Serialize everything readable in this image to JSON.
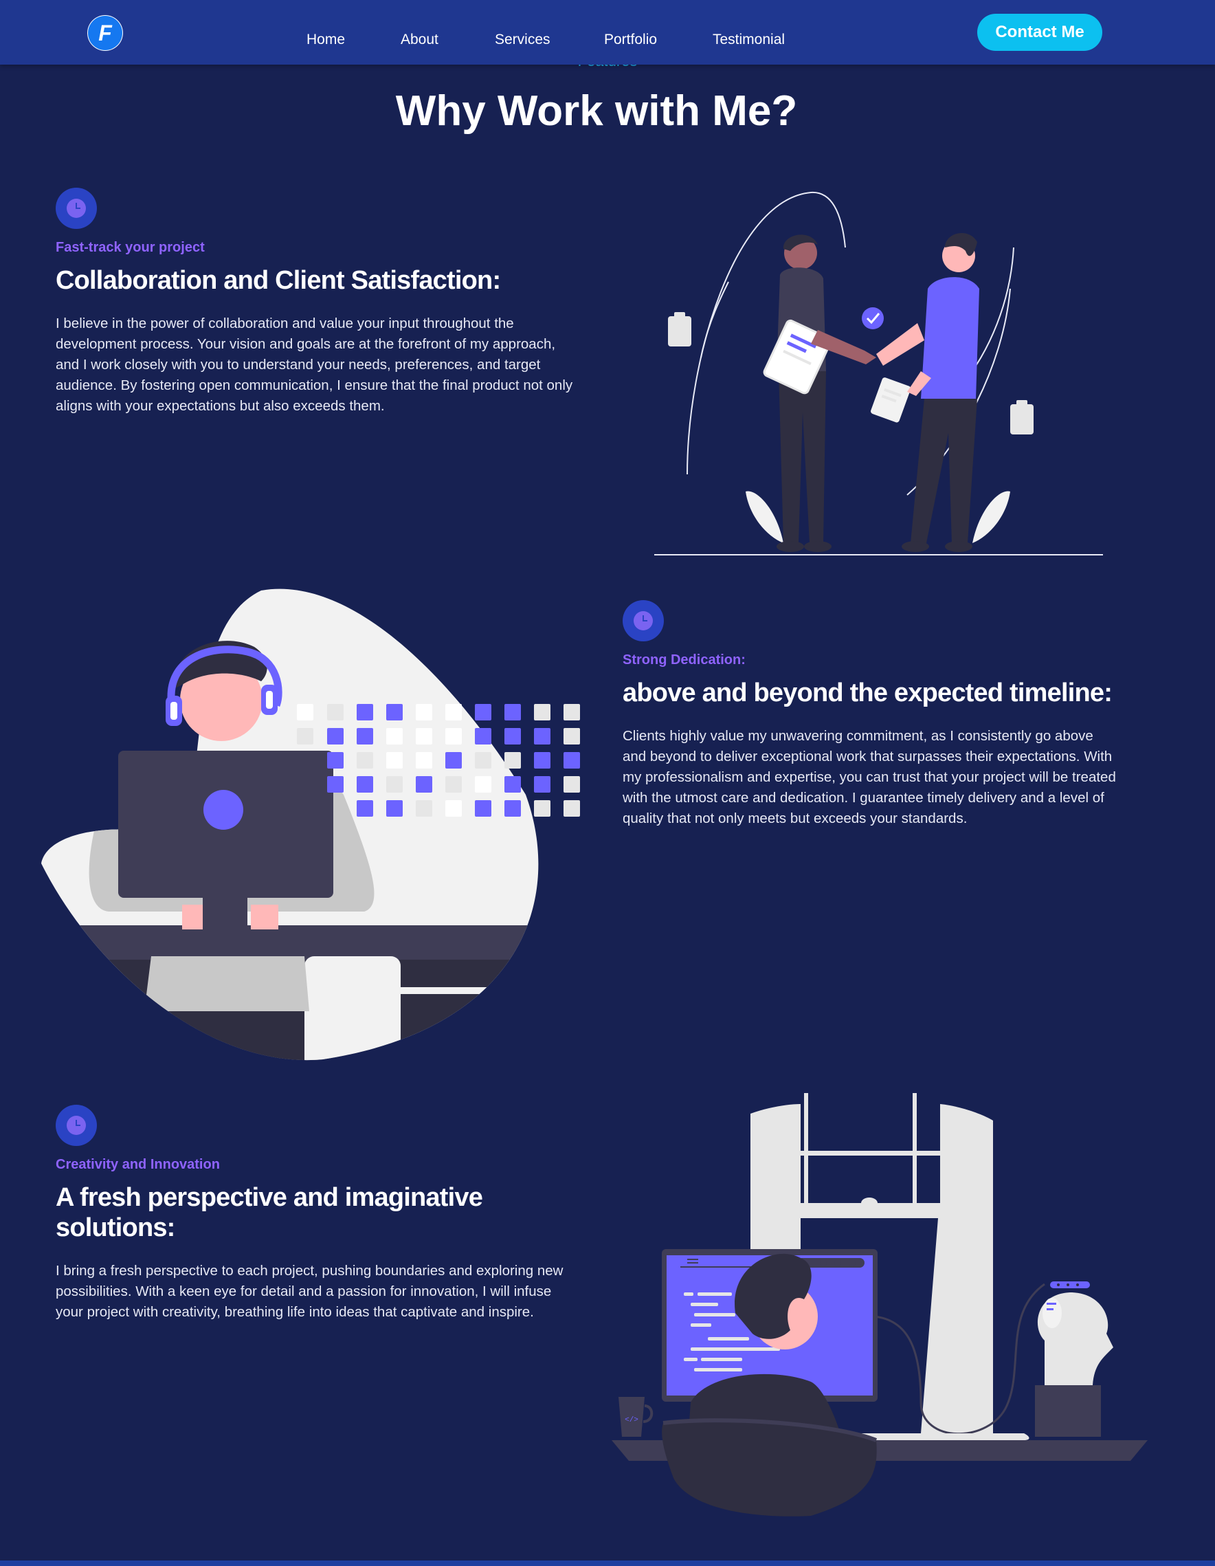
{
  "nav": {
    "logo_letter": "F",
    "links": [
      {
        "label": "Home"
      },
      {
        "label": "About"
      },
      {
        "label": "Services"
      },
      {
        "label": "Portfolio"
      },
      {
        "label": "Testimonial"
      }
    ],
    "contact_label": "Contact Me"
  },
  "section": {
    "eyebrow": "Features",
    "title": "Why Work with Me?"
  },
  "features": [
    {
      "eyebrow": "Fast-track your project",
      "heading": "Collaboration and Client Satisfaction:",
      "body": "I believe in the power of collaboration and value your input throughout the development process. Your vision and goals are at the forefront of my approach, and I work closely with you to understand your needs, preferences, and target audience. By fostering open communication, I ensure that the final product not only aligns with your expectations but also exceeds them.",
      "icon": "clock-icon",
      "illustration": "handshake-illustration"
    },
    {
      "eyebrow": "Strong Dedication:",
      "heading": "above and beyond the expected timeline:",
      "body": "Clients highly value my unwavering commitment, as I consistently go above and beyond to deliver exceptional work that surpasses their expectations. With my professionalism and expertise, you can trust that your project will be treated with the utmost care and dedication. I guarantee timely delivery and a level of quality that not only meets but exceeds your standards.",
      "icon": "clock-icon",
      "illustration": "headset-worker-illustration"
    },
    {
      "eyebrow": "Creativity and Innovation",
      "heading": "A fresh perspective and imaginative solutions:",
      "body": "I bring a fresh perspective to each project, pushing boundaries and exploring new possibilities. With a keen eye for detail and a passion for innovation, I will infuse your project with creativity, breathing life into ideas that captivate and inspire.",
      "icon": "clock-icon",
      "illustration": "developer-desk-illustration"
    }
  ],
  "colors": {
    "page_bg": "#172152",
    "nav_bg": "#1f3790",
    "accent_cyan": "#0cc0f0",
    "accent_purple": "#8f63ff",
    "illustration_purple": "#6c63ff"
  }
}
